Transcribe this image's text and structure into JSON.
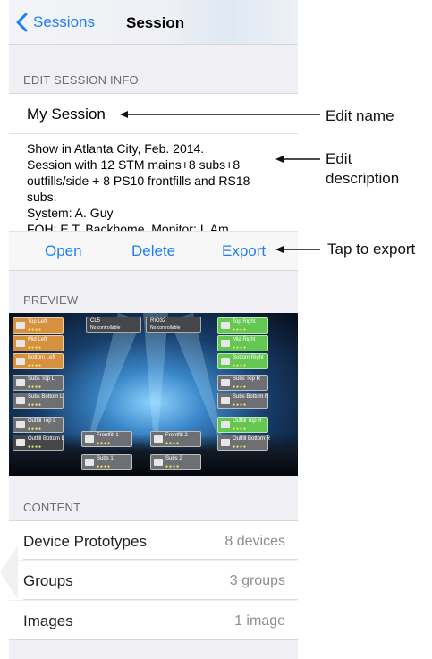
{
  "navbar": {
    "back_label": "Sessions",
    "title": "Session"
  },
  "edit_section": {
    "header": "EDIT SESSION INFO"
  },
  "session": {
    "name": "My Session",
    "description": "Show in Atlanta City, Feb. 2014.\nSession with 12 STM mains+8 subs+8 outfills/side + 8 PS10 frontfills and RS18 subs.\nSystem: A. Guy\nFOH: E.T. Backhome, Monitor: I. Am"
  },
  "actions": {
    "open": "Open",
    "delete": "Delete",
    "export": "Export"
  },
  "preview": {
    "header": "PREVIEW",
    "tiles": {
      "top_left": "Top Left",
      "mid_left": "Mid Left",
      "bottom_left": "Bottom Left",
      "subs_top_l": "Subs Top L",
      "subs_bottom_l": "Subs Bottom L",
      "outfill_top_l": "Outfill Top L",
      "outfill_bottom_l": "Outfill Bottom L",
      "cl5": "CL5",
      "rio32": "RIO32",
      "no_controllable": "No controllable",
      "top_right": "Top Right",
      "mid_right": "Mid Right",
      "bottom_right": "Bottom Right",
      "subs_top_r": "Subs Top R",
      "subs_bottom_r": "Subs Bottom R",
      "outfill_top_r": "Outfill Top R",
      "outfill_bottom_r": "Outfill Bottom R",
      "frontfill_1": "Frontfill 1",
      "frontfill_2": "Frontfill 2",
      "subs_1": "Subs 1",
      "subs_2": "Subs 2"
    }
  },
  "content": {
    "header": "CONTENT",
    "rows": [
      {
        "label": "Device Prototypes",
        "value": "8 devices"
      },
      {
        "label": "Groups",
        "value": "3 groups"
      },
      {
        "label": "Images",
        "value": "1 image"
      }
    ]
  },
  "annotations": {
    "edit_name": "Edit name",
    "edit_description": "Edit\ndescription",
    "tap_to_export": "Tap to export"
  },
  "colors": {
    "accent": "#1d7ef7",
    "group_background": "#efeff4"
  }
}
